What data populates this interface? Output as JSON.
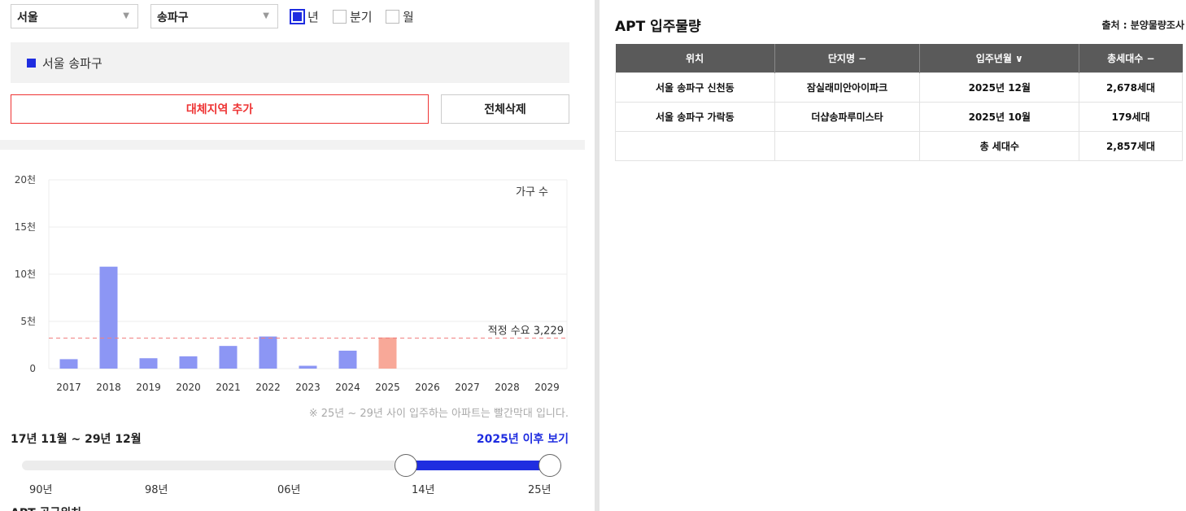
{
  "filters": {
    "city": "서울",
    "district": "송파구",
    "periods": [
      {
        "label": "년",
        "checked": true
      },
      {
        "label": "분기",
        "checked": false
      },
      {
        "label": "월",
        "checked": false
      }
    ]
  },
  "region": {
    "selected": "서울 송파구"
  },
  "buttons": {
    "add_region": "대체지역 추가",
    "clear_all": "전체삭제"
  },
  "chart_data": {
    "type": "bar",
    "categories": [
      "2017",
      "2018",
      "2019",
      "2020",
      "2021",
      "2022",
      "2023",
      "2024",
      "2025",
      "2026",
      "2027",
      "2028",
      "2029"
    ],
    "values": [
      1000,
      10800,
      1100,
      1300,
      2400,
      3400,
      300,
      1900,
      3300,
      0,
      0,
      0,
      0
    ],
    "highlight_from": "2025",
    "y_ticks": [
      "0",
      "5천",
      "10천",
      "15천",
      "20천"
    ],
    "ylim": [
      0,
      20000
    ],
    "series_label": "가구 수",
    "reference_line": {
      "value": 3229,
      "label": "적정 수요 3,229"
    },
    "colors": {
      "bar": "#8c96f4",
      "highlight": "#f8a898",
      "reference": "#f08080"
    }
  },
  "note": "※ 25년 ~ 29년 사이 입주하는 아파트는 빨간막대 입니다.",
  "range": {
    "label": "17년 11월 ~ 29년 12월",
    "after_link": "2025년 이후 보기",
    "ticks": [
      "90년",
      "98년",
      "06년",
      "14년",
      "25년"
    ]
  },
  "bottom_title": "APT 공급위치",
  "apt": {
    "title": "APT 입주물량",
    "source": "출처 : 분양물량조사",
    "headers": [
      "위치",
      "단지명 −",
      "입주년월 ∨",
      "총세대수 −"
    ],
    "rows": [
      [
        "서울 송파구 신천동",
        "잠실래미안아이파크",
        "2025년 12월",
        "2,678세대"
      ],
      [
        "서울 송파구 가락동",
        "더샵송파루미스타",
        "2025년 10월",
        "179세대"
      ]
    ],
    "total_label": "총 세대수",
    "total_value": "2,857세대"
  },
  "colors": {
    "accent": "#1f2de0",
    "danger": "#e33333"
  }
}
